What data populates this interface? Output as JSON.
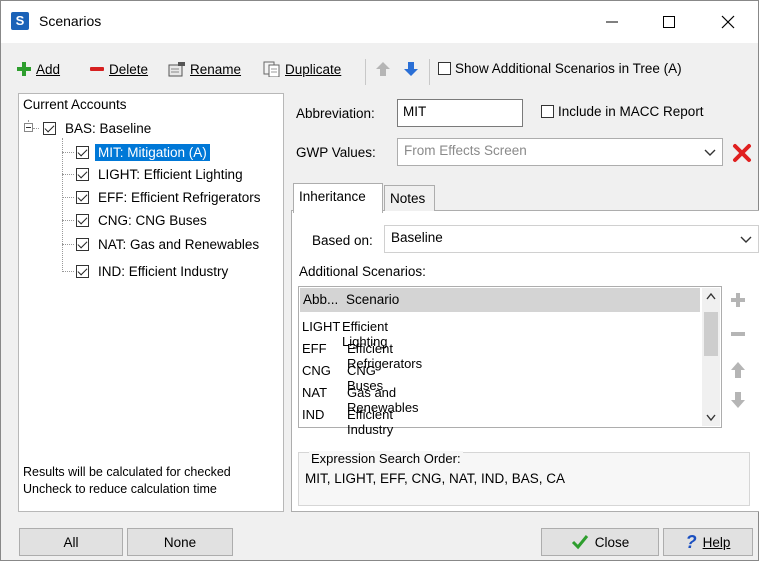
{
  "window": {
    "title": "Scenarios",
    "icon_letter": "S"
  },
  "toolbar": {
    "add": "Add",
    "delete": "Delete",
    "rename": "Rename",
    "duplicate": "Duplicate",
    "show_additional": "Show Additional Scenarios in Tree (A)"
  },
  "tree": {
    "root": "Current Accounts",
    "baseline": "BAS: Baseline",
    "items": [
      {
        "label": "MIT: Mitigation (A)",
        "checked": true,
        "selected": true
      },
      {
        "label": "LIGHT: Efficient Lighting",
        "checked": true
      },
      {
        "label": "EFF: Efficient Refrigerators",
        "checked": true
      },
      {
        "label": "CNG: CNG Buses",
        "checked": true
      },
      {
        "label": "NAT: Gas and Renewables",
        "checked": true
      },
      {
        "label": "IND: Efficient Industry",
        "checked": true
      }
    ],
    "footer_line1": "Results will be calculated for checked",
    "footer_line2": "Uncheck to reduce calculation time"
  },
  "buttons": {
    "all": "All",
    "none": "None",
    "close": "Close",
    "help": "Help"
  },
  "form": {
    "abbreviation_label": "Abbreviation:",
    "abbreviation_value": "MIT",
    "include_macc": "Include in MACC Report",
    "gwp_label": "GWP Values:",
    "gwp_value": "From Effects Screen"
  },
  "tabs": {
    "inheritance": "Inheritance",
    "notes": "Notes"
  },
  "inheritance": {
    "based_on_label": "Based on:",
    "based_on_value": "Baseline",
    "additional_label": "Additional Scenarios:",
    "col_abb": "Abb...",
    "col_scenario": "Scenario",
    "rows": [
      {
        "abb": "LIGHT",
        "scenario": "Efficient Lighting"
      },
      {
        "abb": "EFF",
        "scenario": "Efficient Refrigerators"
      },
      {
        "abb": "CNG",
        "scenario": "CNG Buses"
      },
      {
        "abb": "NAT",
        "scenario": "Gas and Renewables"
      },
      {
        "abb": "IND",
        "scenario": "Efficient Industry"
      }
    ],
    "search_order_label": "Expression Search Order:",
    "search_order_value": "MIT, LIGHT, EFF, CNG, NAT, IND, BAS, CA"
  },
  "colors": {
    "selection": "#0078d7",
    "add_green": "#2e9e2e",
    "delete_red": "#d62020",
    "arrow_blue": "#2a6fd6"
  }
}
